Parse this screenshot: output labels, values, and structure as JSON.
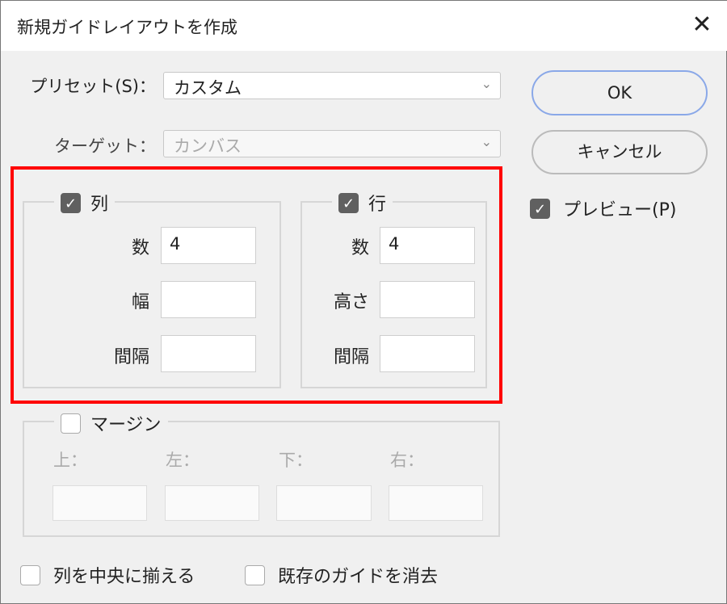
{
  "dialog": {
    "title": "新規ガイドレイアウトを作成",
    "close_icon": "close-icon"
  },
  "preset": {
    "label": "プリセット(S)：",
    "value": "カスタム"
  },
  "target": {
    "label": "ターゲット：",
    "value": "カンバス"
  },
  "buttons": {
    "ok": "OK",
    "cancel": "キャンセル"
  },
  "preview": {
    "label": "プレビュー(P)",
    "checked": true
  },
  "columns": {
    "label": "列",
    "checked": true,
    "count_label": "数",
    "count": "4",
    "width_label": "幅",
    "width": "",
    "gutter_label": "間隔",
    "gutter": ""
  },
  "rows": {
    "label": "行",
    "checked": true,
    "count_label": "数",
    "count": "4",
    "height_label": "高さ",
    "height": "",
    "gutter_label": "間隔",
    "gutter": ""
  },
  "margin": {
    "label": "マージン",
    "checked": false,
    "top_label": "上：",
    "left_label": "左：",
    "bottom_label": "下：",
    "right_label": "右：",
    "top": "",
    "left": "",
    "bottom": "",
    "right": ""
  },
  "options": {
    "center_columns": "列を中央に揃える",
    "clear_existing": "既存のガイドを消去"
  },
  "colors": {
    "highlight": "#ff0000",
    "ok_border": "#8aa8e8"
  }
}
